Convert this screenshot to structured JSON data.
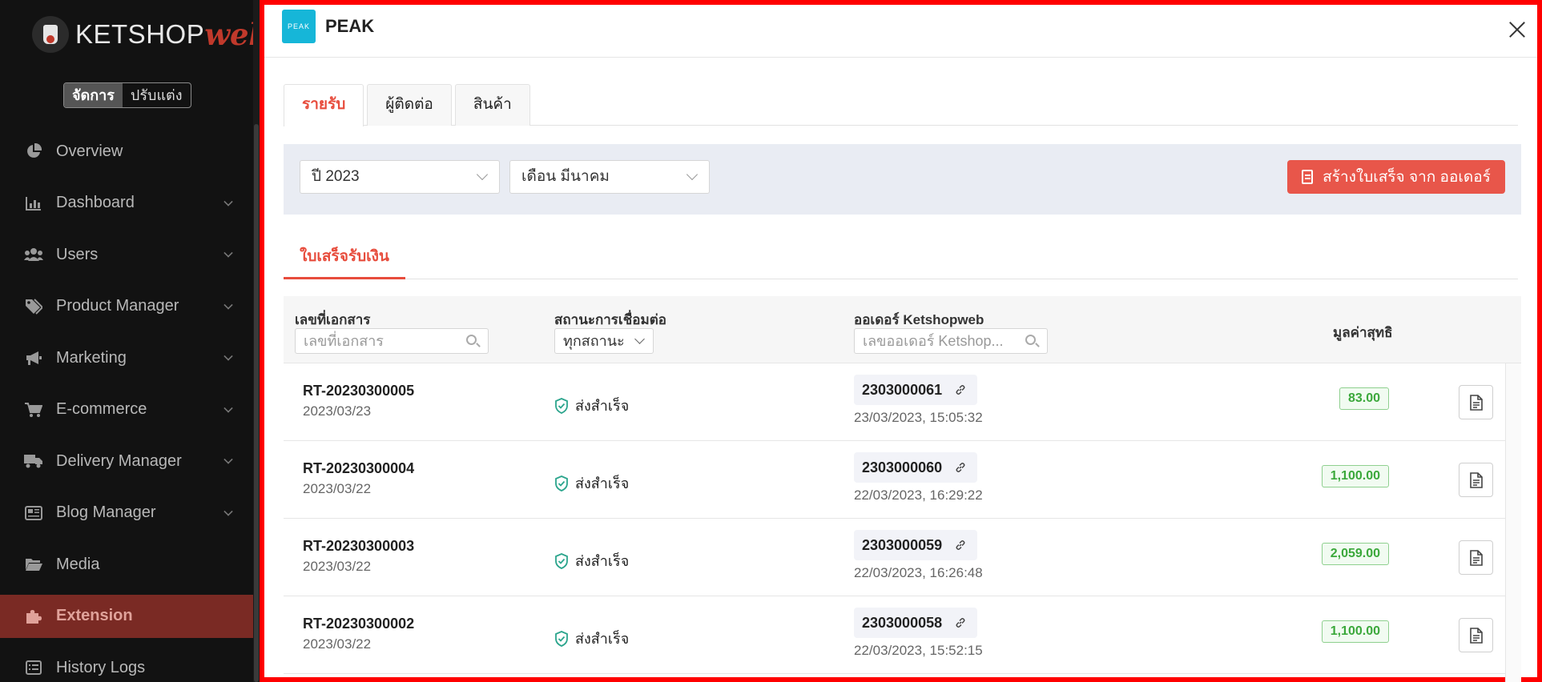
{
  "app": {
    "logo_text": "KETSHOP",
    "logo_accent": "web"
  },
  "mode_toggle": {
    "manage": "จัดการ",
    "customize": "ปรับแต่ง"
  },
  "sidebar": {
    "items": [
      {
        "label": "Overview",
        "icon": "pie-chart-icon",
        "has_children": false
      },
      {
        "label": "Dashboard",
        "icon": "bar-chart-icon",
        "has_children": true
      },
      {
        "label": "Users",
        "icon": "users-icon",
        "has_children": true
      },
      {
        "label": "Product Manager",
        "icon": "tags-icon",
        "has_children": true
      },
      {
        "label": "Marketing",
        "icon": "megaphone-icon",
        "has_children": true
      },
      {
        "label": "E-commerce",
        "icon": "cart-icon",
        "has_children": true
      },
      {
        "label": "Delivery Manager",
        "icon": "truck-icon",
        "has_children": true
      },
      {
        "label": "Blog Manager",
        "icon": "newspaper-icon",
        "has_children": true
      },
      {
        "label": "Media",
        "icon": "folder-open-icon",
        "has_children": false
      },
      {
        "label": "Extension",
        "icon": "puzzle-icon",
        "has_children": false,
        "active": true
      },
      {
        "label": "History Logs",
        "icon": "list-icon",
        "has_children": false
      }
    ]
  },
  "modal": {
    "logo_text": "PEAK",
    "title": "PEAK",
    "tabs": [
      {
        "label": "รายรับ",
        "active": true
      },
      {
        "label": "ผู้ติดต่อ",
        "active": false
      },
      {
        "label": "สินค้า",
        "active": false
      }
    ],
    "filters": {
      "year": "ปี 2023",
      "month": "เดือน มีนาคม",
      "create_button": "สร้างใบเสร็จ จาก ออเดอร์"
    },
    "subtab": "ใบเสร็จรับเงิน",
    "table": {
      "columns": {
        "doc_no": "เลขที่เอกสาร",
        "status": "สถานะการเชื่อมต่อ",
        "order": "ออเดอร์ Ketshopweb",
        "net": "มูลค่าสุทธิ"
      },
      "doc_no_placeholder": "เลขที่เอกสาร",
      "status_filter": "ทุกสถานะ",
      "order_placeholder": "เลขออเดอร์ Ketshop...",
      "rows": [
        {
          "doc_no": "RT-20230300005",
          "date": "2023/03/23",
          "status": "ส่งสำเร็จ",
          "order_no": "2303000061",
          "order_datetime": "23/03/2023, 15:05:32",
          "amount": "83.00"
        },
        {
          "doc_no": "RT-20230300004",
          "date": "2023/03/22",
          "status": "ส่งสำเร็จ",
          "order_no": "2303000060",
          "order_datetime": "22/03/2023, 16:29:22",
          "amount": "1,100.00"
        },
        {
          "doc_no": "RT-20230300003",
          "date": "2023/03/22",
          "status": "ส่งสำเร็จ",
          "order_no": "2303000059",
          "order_datetime": "22/03/2023, 16:26:48",
          "amount": "2,059.00"
        },
        {
          "doc_no": "RT-20230300002",
          "date": "2023/03/22",
          "status": "ส่งสำเร็จ",
          "order_no": "2303000058",
          "order_datetime": "22/03/2023, 15:52:15",
          "amount": "1,100.00"
        }
      ]
    }
  },
  "colors": {
    "sidebar_bg": "#121212",
    "active_nav": "#7a2a24",
    "accent_red": "#e74c3c",
    "button_red": "#e8564a",
    "peak_blue": "#16b6d8",
    "success_green": "#3ba83b",
    "highlight_border": "#ff0000"
  }
}
